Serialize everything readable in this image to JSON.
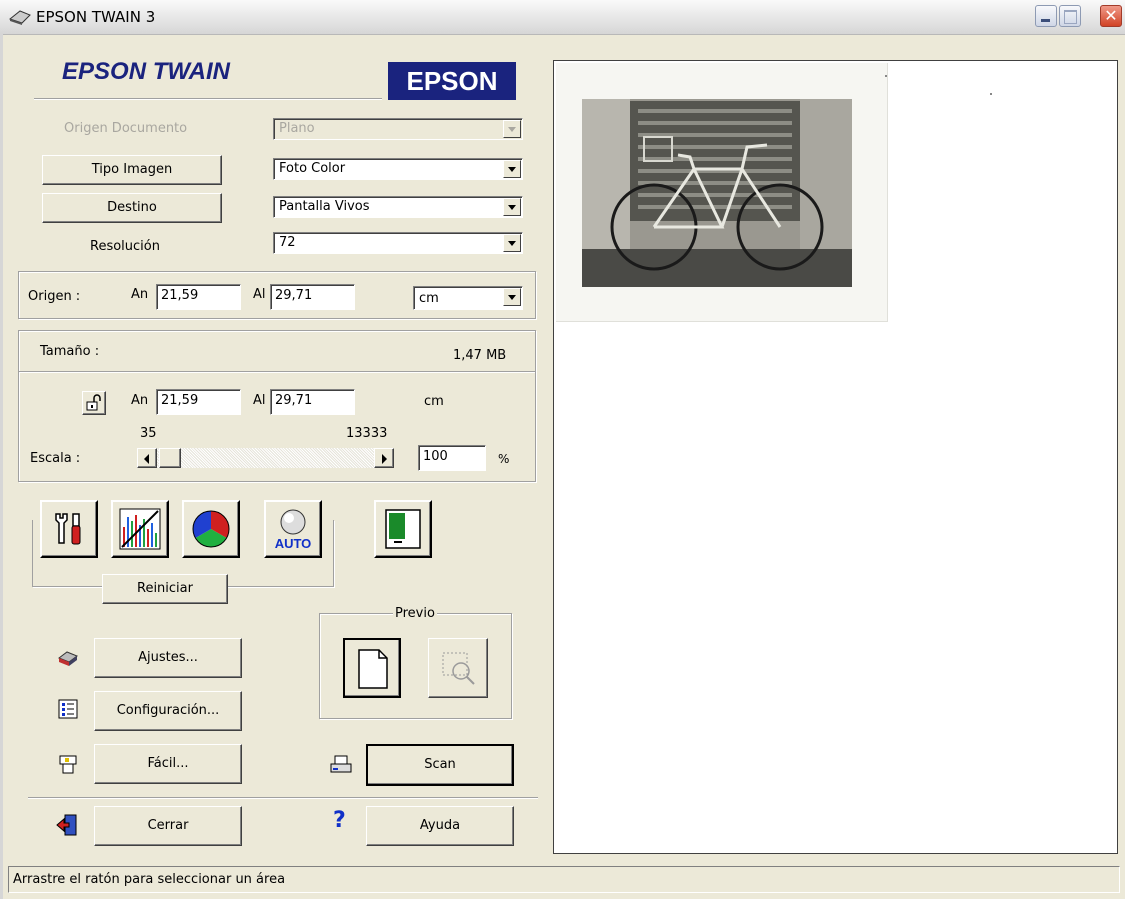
{
  "window": {
    "title": "EPSON TWAIN 3"
  },
  "header": {
    "product": "EPSON TWAIN",
    "brand": "EPSON"
  },
  "source": {
    "label": "Origen Documento",
    "value": "Plano"
  },
  "image_type": {
    "button": "Tipo Imagen",
    "value": "Foto Color"
  },
  "destination": {
    "button": "Destino",
    "value": "Pantalla Vivos"
  },
  "resolution": {
    "label": "Resolución",
    "value": "72"
  },
  "origin": {
    "label": "Origen :",
    "width_label": "An",
    "width": "21,59",
    "height_label": "Al",
    "height": "29,71",
    "unit": "cm"
  },
  "size": {
    "label": "Tamaño :",
    "filesize": "1,47 MB",
    "width_label": "An",
    "width": "21,59",
    "height_label": "Al",
    "height": "29,71",
    "unit": "cm"
  },
  "scale": {
    "label": "Escala :",
    "min": "35",
    "max": "13333",
    "value": "100",
    "unit": "%"
  },
  "tools": {
    "reset_button": "Reiniciar",
    "icons": [
      "tools-icon",
      "histogram-icon",
      "color-wheel-icon",
      "auto-exposure-icon",
      "unsharp-icon"
    ]
  },
  "preview": {
    "group_label": "Previo"
  },
  "buttons": {
    "settings": "Ajustes...",
    "configuration": "Configuración...",
    "easy": "Fácil...",
    "scan": "Scan",
    "close": "Cerrar",
    "help": "Ayuda",
    "help_glyph": "?"
  },
  "status": {
    "text": "Arrastre el ratón para seleccionar un área"
  },
  "colors": {
    "brand_blue": "#1a237e",
    "title_bar_close": "#d14326",
    "help_blue": "#1030c8"
  }
}
